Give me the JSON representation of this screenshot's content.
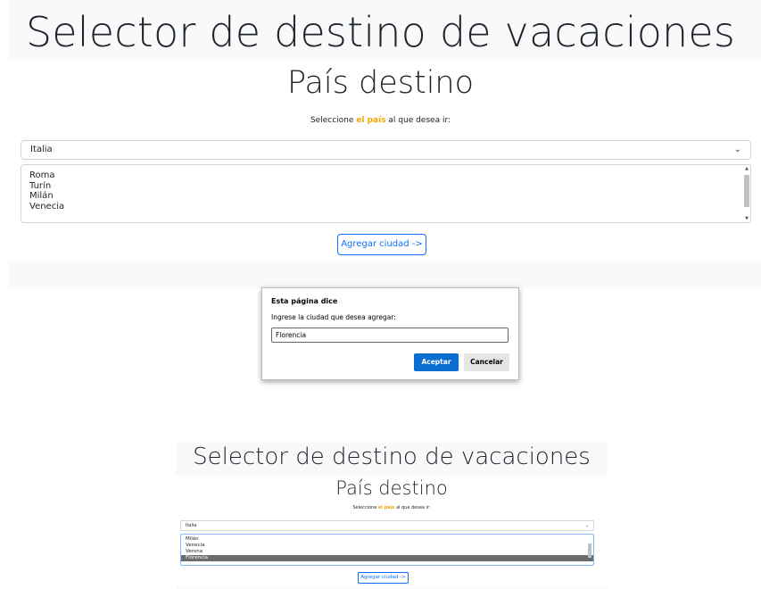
{
  "panel1": {
    "title": "Selector de destino de vacaciones",
    "heading": "País destino",
    "instruction_before": "Seleccione ",
    "instruction_highlight": "el país",
    "instruction_after": " al que desea ir:",
    "country_selected": "Italia",
    "cities": [
      "Roma",
      "Turín",
      "Milán",
      "Venecia"
    ],
    "add_button": "Agregar ciudad ->"
  },
  "dialog": {
    "title": "Esta página dice",
    "message": "Ingrese la ciudad que desea agregar:",
    "input_value": "Florencia",
    "ok_label": "Aceptar",
    "cancel_label": "Cancelar",
    "ok_color": "#0a6ed1"
  },
  "panel2": {
    "title": "Selector de destino de vacaciones",
    "heading": "País destino",
    "instruction_before": "Seleccione ",
    "instruction_highlight": "el país",
    "instruction_after": " al que desea ir:",
    "country_selected": "Italia",
    "cities": [
      "Milán",
      "Venecia",
      "Verona",
      "Florencia"
    ],
    "selected_city": "Florencia",
    "add_button": "Agregar ciudad ->"
  },
  "colors": {
    "highlight": "#f0a500",
    "primary": "#0d6efd",
    "panel_background": "#f8f9fa"
  },
  "icons": {
    "select_chevron": "chevron-down-icon"
  }
}
